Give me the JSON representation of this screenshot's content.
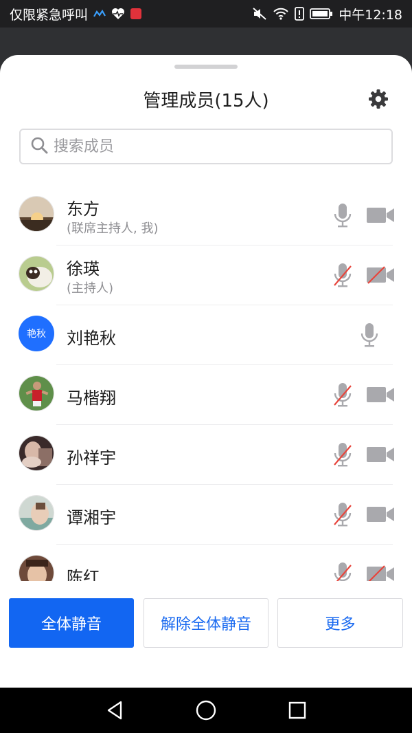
{
  "status_bar": {
    "carrier": "仅限紧急呼叫",
    "time": "中午12:18"
  },
  "panel": {
    "title": "管理成员(15人)"
  },
  "search": {
    "placeholder": "搜索成员"
  },
  "members": [
    {
      "name": "东方",
      "role": "(联席主持人, 我)",
      "mic": "on",
      "camera": "on"
    },
    {
      "name": "徐瑛",
      "role": "(主持人)",
      "mic": "muted",
      "camera": "off"
    },
    {
      "name": "刘艳秋",
      "avatar_text": "艳秋",
      "mic": "on",
      "camera": "none"
    },
    {
      "name": "马楷翔",
      "mic": "muted",
      "camera": "on"
    },
    {
      "name": "孙祥宇",
      "mic": "muted",
      "camera": "on"
    },
    {
      "name": "谭湘宇",
      "mic": "muted",
      "camera": "on"
    },
    {
      "name": "陈红",
      "mic": "muted",
      "camera": "off"
    }
  ],
  "actions": {
    "mute_all": "全体静音",
    "unmute_all": "解除全体静音",
    "more": "更多"
  },
  "colors": {
    "accent": "#1266f2",
    "muted_slash": "#e8453c",
    "icon_gray": "#a9a9ad"
  }
}
